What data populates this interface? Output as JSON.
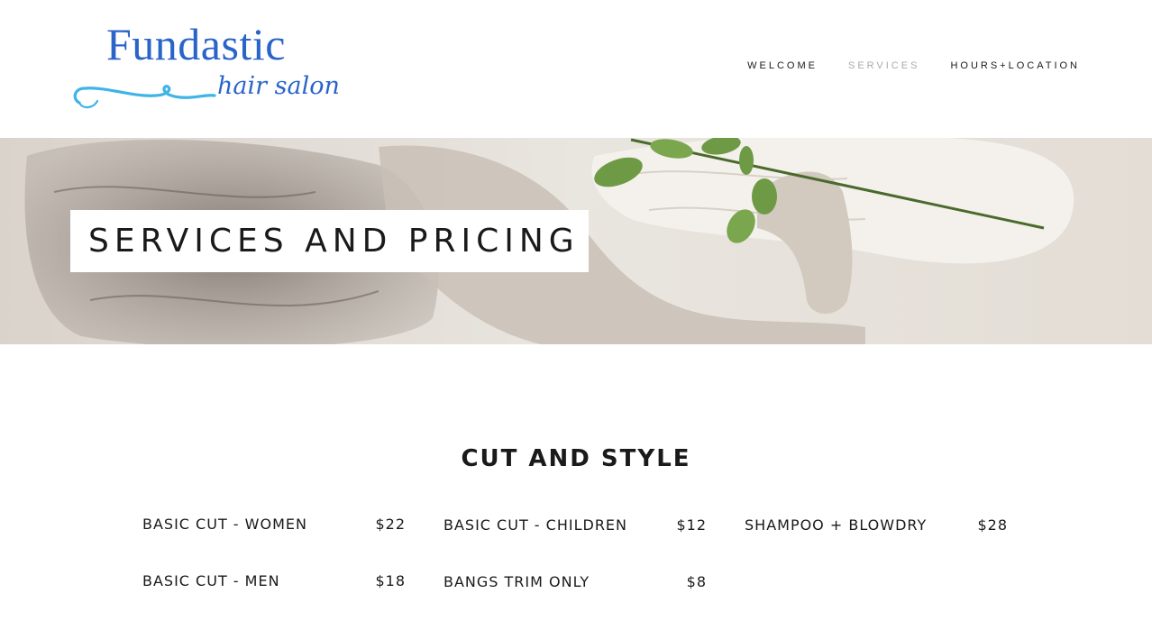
{
  "logo": {
    "title": "Fundastic",
    "subtitle": "hair salon",
    "colors": {
      "primary": "#2a64c9",
      "swoosh": "#3fb4e6"
    }
  },
  "nav": {
    "items": [
      {
        "label": "WELCOME",
        "active": false
      },
      {
        "label": "SERVICES",
        "active": true
      },
      {
        "label": "HOURS+LOCATION",
        "active": false
      }
    ]
  },
  "banner": {
    "title": "SERVICES AND PRICING"
  },
  "services": {
    "title": "CUT AND STYLE",
    "columns": [
      [
        {
          "name": "BASIC CUT - WOMEN",
          "price": "$22"
        },
        {
          "name": "BASIC CUT - MEN",
          "price": "$18"
        }
      ],
      [
        {
          "name": "BASIC CUT - CHILDREN",
          "price": "$12"
        },
        {
          "name": "BANGS TRIM ONLY",
          "price": "$8"
        }
      ],
      [
        {
          "name": "SHAMPOO + BLOWDRY",
          "price": "$28"
        }
      ]
    ]
  }
}
